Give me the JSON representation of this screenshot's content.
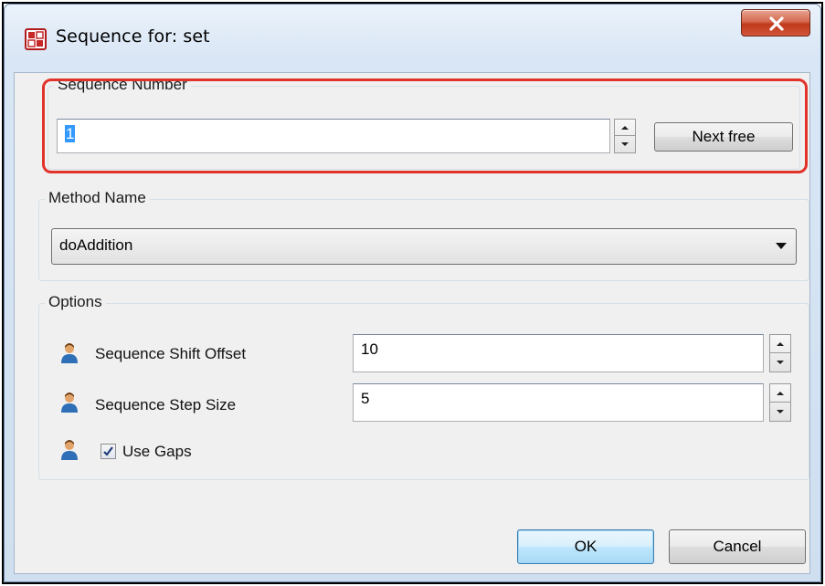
{
  "window": {
    "title": "Sequence for: set",
    "close_glyph": "X"
  },
  "sequence_number": {
    "legend": "Sequence Number",
    "value": "1",
    "next_free_label": "Next free"
  },
  "method_name": {
    "legend": "Method Name",
    "selected": "doAddition"
  },
  "options": {
    "legend": "Options",
    "shift_offset": {
      "label": "Sequence Shift Offset",
      "value": "10"
    },
    "step_size": {
      "label": "Sequence Step Size",
      "value": "5"
    },
    "use_gaps": {
      "label": "Use Gaps",
      "checked": true
    }
  },
  "footer": {
    "ok_label": "OK",
    "cancel_label": "Cancel"
  },
  "icons": {
    "app": "sequence-app-icon",
    "person": "person-icon",
    "close": "close-icon"
  },
  "colors": {
    "highlight": "#e2332b",
    "selection": "#3399ff",
    "close_button": "#c0391a"
  }
}
